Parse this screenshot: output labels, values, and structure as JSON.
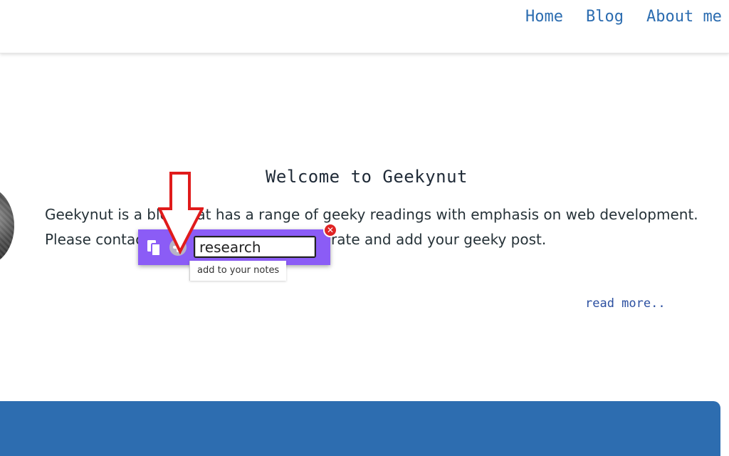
{
  "nav": {
    "items": [
      {
        "label": "Home"
      },
      {
        "label": "Blog"
      },
      {
        "label": "About me"
      }
    ]
  },
  "welcome": {
    "title": "Welcome to Geekynut",
    "intro": "Geekynut is a blog that has a range of geeky readings with emphasis on web development. Please contact me if you wish to collaborate and add your geeky post.",
    "read_more": "read more.."
  },
  "note_toolbar": {
    "input_value": "research",
    "tooltip": "add to your notes",
    "close_symbol": "✕",
    "icons": [
      "copy-icon",
      "add-note-icon",
      "close-icon"
    ],
    "accent_color": "#8b5cf6"
  },
  "annotation": {
    "arrow_color": "#e01b1b"
  },
  "banner": {
    "color": "#2d6db0"
  }
}
